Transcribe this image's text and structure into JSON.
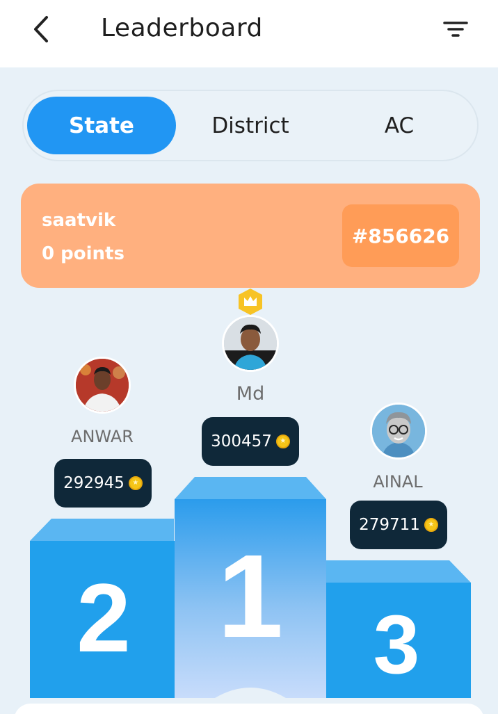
{
  "header": {
    "title": "Leaderboard",
    "back_icon": "chevron-left-icon",
    "filter_icon": "filter-icon"
  },
  "tabs": [
    {
      "label": "State",
      "active": true
    },
    {
      "label": "District",
      "active": false
    },
    {
      "label": "AC",
      "active": false
    }
  ],
  "my_rank": {
    "name": "saatvik",
    "points": "0 points",
    "rank": "#856626"
  },
  "podium": [
    {
      "position": "1",
      "name": "Md",
      "score": "300457"
    },
    {
      "position": "2",
      "name": "ANWAR",
      "score": "292945"
    },
    {
      "position": "3",
      "name": "AINAL",
      "score": "279711"
    }
  ],
  "colors": {
    "accent": "#2196f3",
    "card": "#ffb07f",
    "badge": "#ff9c57",
    "score_bg": "#0f2839",
    "podium": "#28a0ec",
    "crown": "#f7c325"
  }
}
